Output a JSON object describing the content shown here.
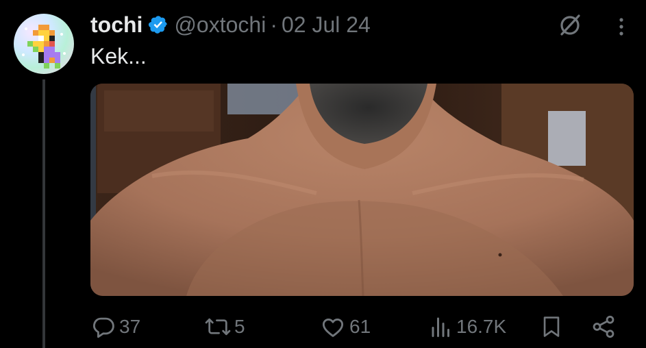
{
  "tweet": {
    "display_name": "tochi",
    "handle": "@oxtochi",
    "separator": "·",
    "date": "02 Jul 24",
    "text": "Kek...",
    "verified": true,
    "image_alt": "Close-up photo of a bearded man's bare neck and shoulders",
    "actions": {
      "replies": "37",
      "reposts": "5",
      "likes": "61",
      "views": "16.7K"
    }
  },
  "colors": {
    "background": "#000000",
    "primary_text": "#e7e9ea",
    "secondary_text": "#71767b",
    "verified_badge": "#1d9bf0",
    "thread_line": "#333639"
  },
  "icons": {
    "verified": "verified-badge-icon",
    "grok": "grok-icon",
    "more": "more-vertical-icon",
    "reply": "reply-bubble-icon",
    "repost": "repost-arrows-icon",
    "like": "heart-icon",
    "views": "bar-chart-icon",
    "bookmark": "bookmark-icon",
    "share": "share-icon"
  }
}
